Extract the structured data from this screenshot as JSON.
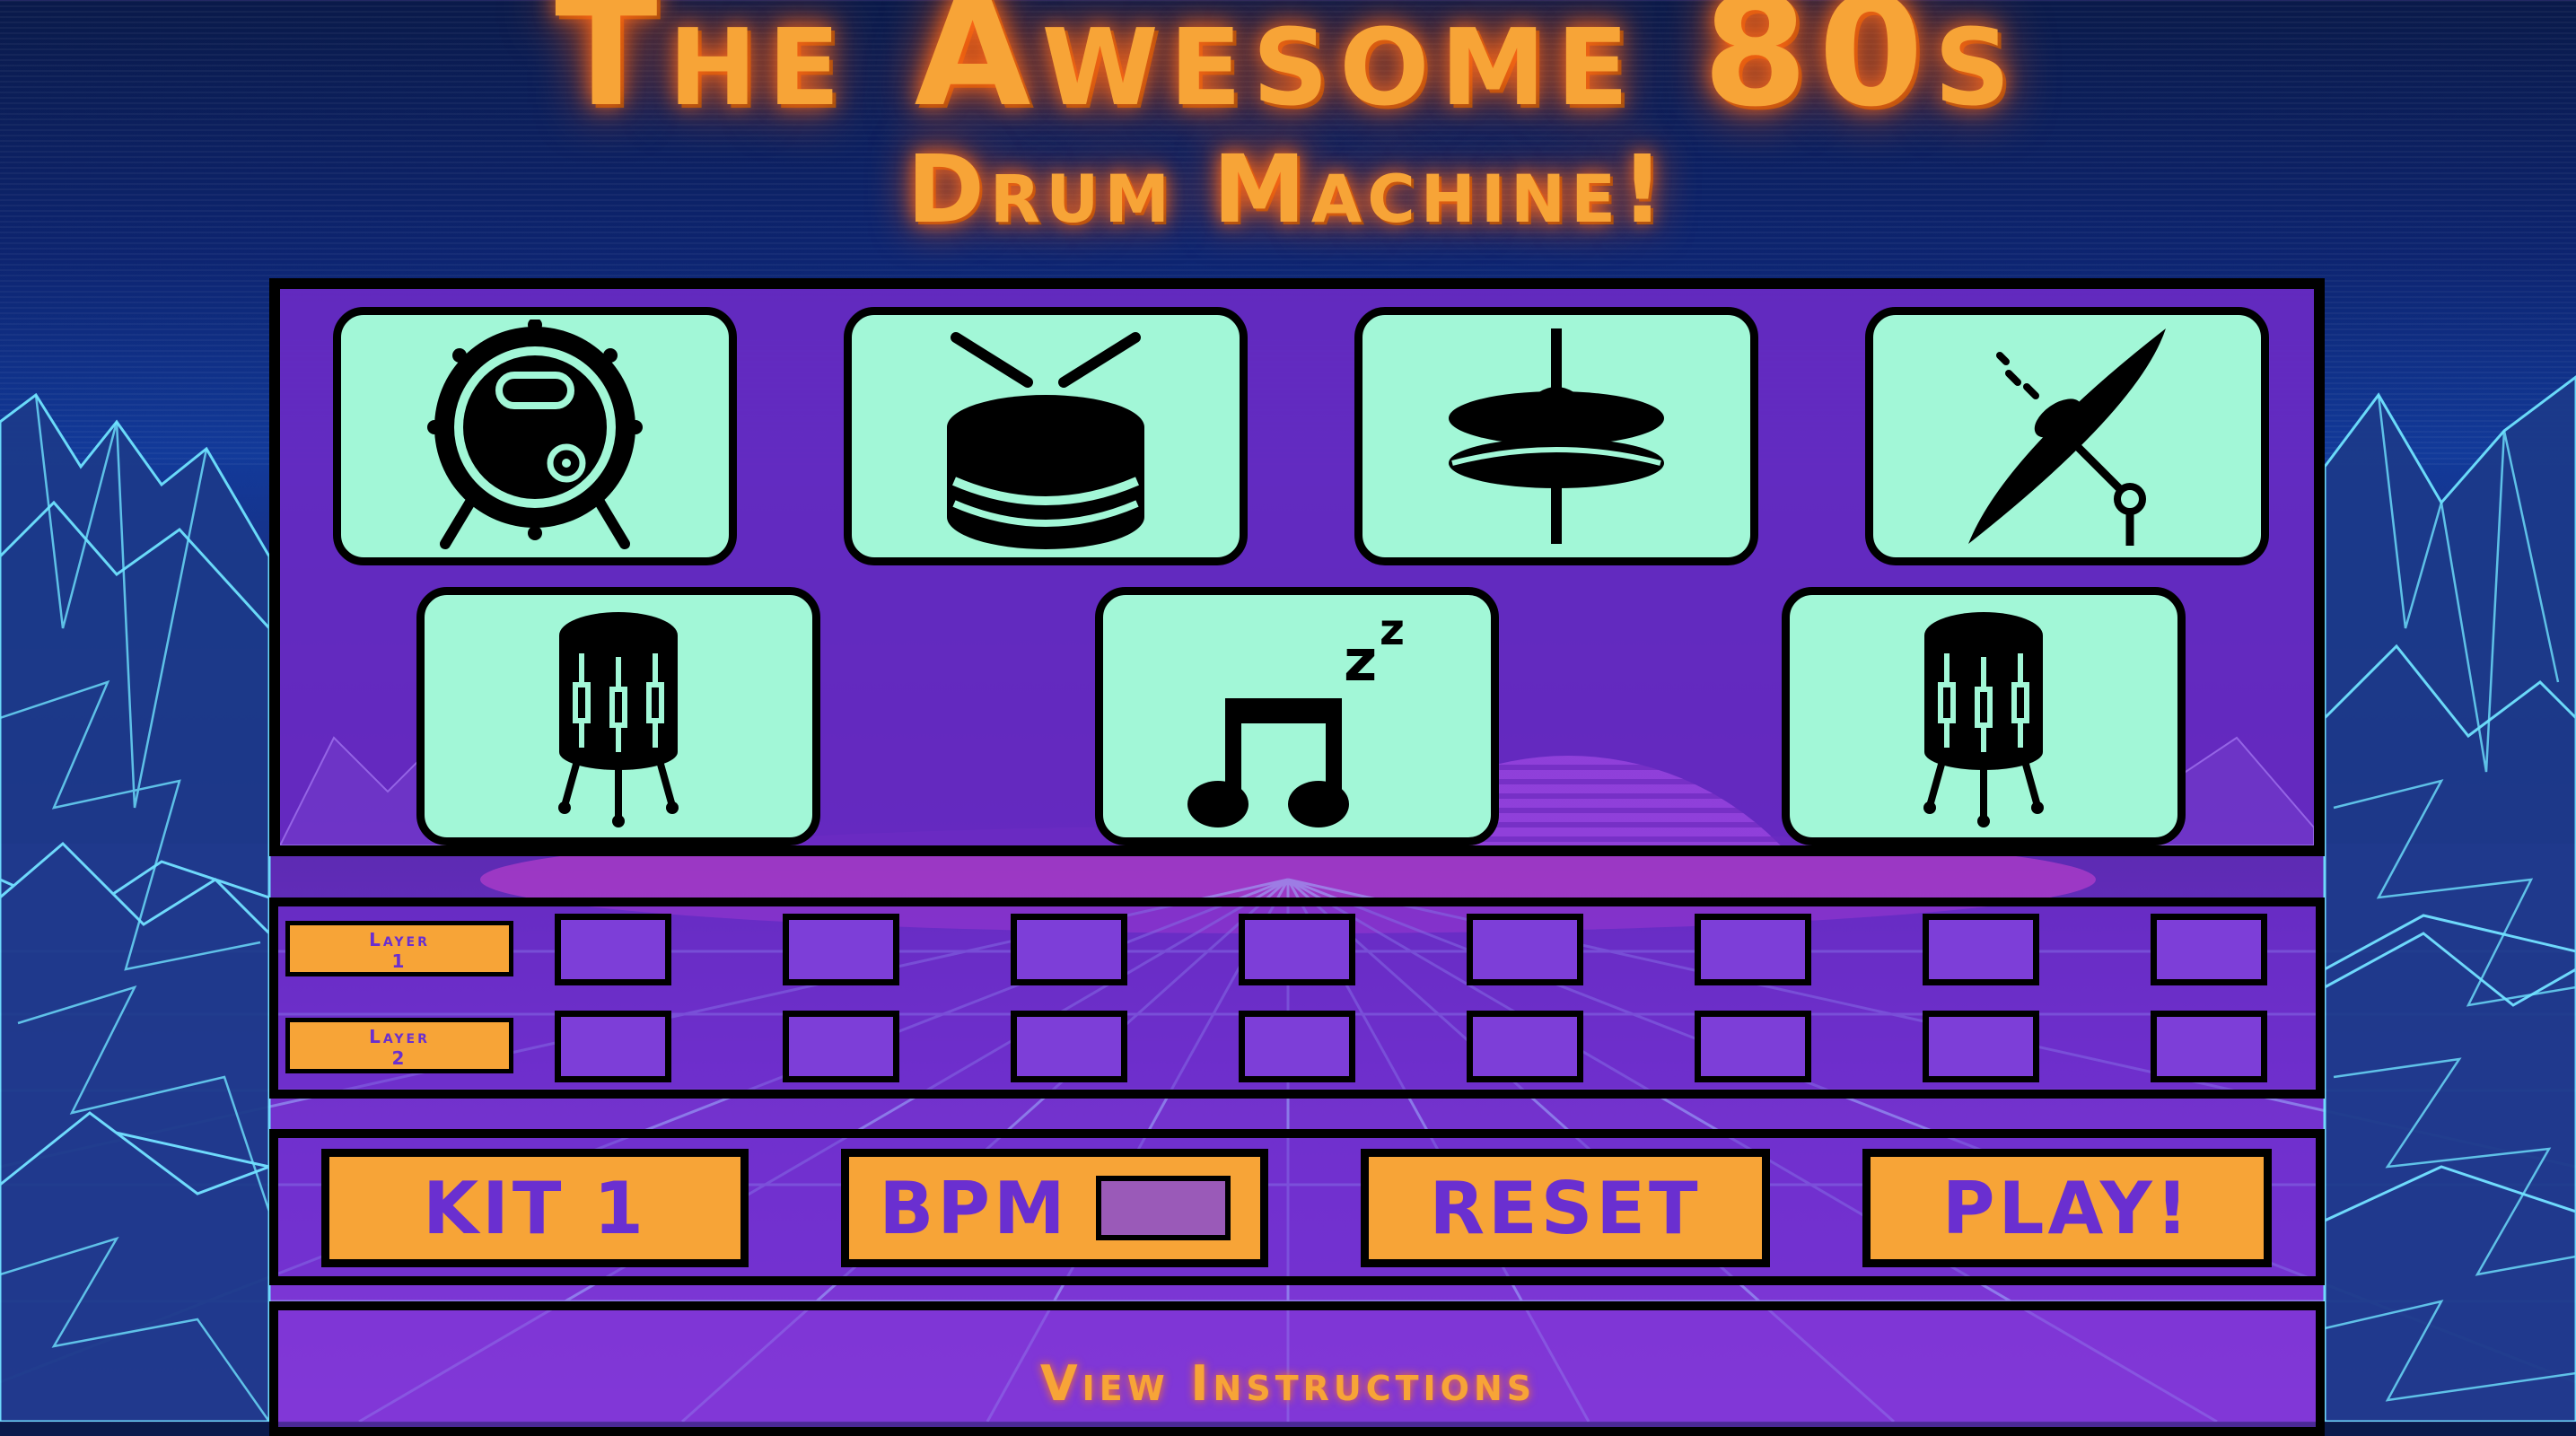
{
  "header": {
    "title": "The Awesome 80s",
    "subtitle": "Drum Machine!"
  },
  "pads": [
    {
      "name": "bass-drum-pad",
      "icon": "bass-drum-icon"
    },
    {
      "name": "snare-drum-pad",
      "icon": "snare-drum-icon"
    },
    {
      "name": "hi-hat-pad",
      "icon": "hi-hat-icon"
    },
    {
      "name": "crash-cymbal-pad",
      "icon": "crash-cymbal-icon"
    },
    {
      "name": "tom-left-pad",
      "icon": "floor-tom-icon"
    },
    {
      "name": "rest-pad",
      "icon": "sleeping-music-note-icon"
    },
    {
      "name": "tom-right-pad",
      "icon": "floor-tom-icon"
    }
  ],
  "sequencer": {
    "layers": [
      {
        "label_line1": "Layer",
        "label_line2": "1"
      },
      {
        "label_line1": "Layer",
        "label_line2": "2"
      }
    ],
    "steps_per_layer": 8
  },
  "controls": {
    "kit_label": "KIT 1",
    "bpm_label": "BPM",
    "bpm_value": "",
    "reset_label": "RESET",
    "play_label": "PLAY!"
  },
  "footer": {
    "instructions_label": "View Instructions"
  },
  "colors": {
    "pad_bg": "#a2f7d7",
    "panel_purple": "#682ac4",
    "accent_orange": "#f7a437",
    "text_purple": "#6a2fd0",
    "step_purple": "#7d3ed8",
    "grid_cyan": "#6fe3ff"
  }
}
